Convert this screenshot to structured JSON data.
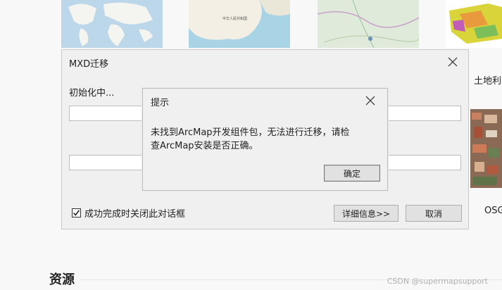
{
  "background": {
    "side_labels": {
      "top": "土地利",
      "bottom": "OSG"
    },
    "section_title": "资源",
    "watermark": "CSDN @supermapsupport",
    "thumb_map_labels": [
      "中华人民共和国"
    ]
  },
  "main_dialog": {
    "title": "MXD迁移",
    "status": "初始化中...",
    "checkbox_label": "成功完成时关闭此对话框",
    "checkbox_checked": true,
    "details_button": "详细信息>>",
    "cancel_button": "取消"
  },
  "tip_dialog": {
    "title": "提示",
    "message_line1": "未找到ArcMap开发组件包，无法进行迁移，请检",
    "message_line2": "查ArcMap安装是否正确。",
    "ok_button": "确定"
  },
  "colors": {
    "dialog_bg": "#f0f0f0",
    "button_bg": "#e1e1e1",
    "border": "#adadad"
  }
}
